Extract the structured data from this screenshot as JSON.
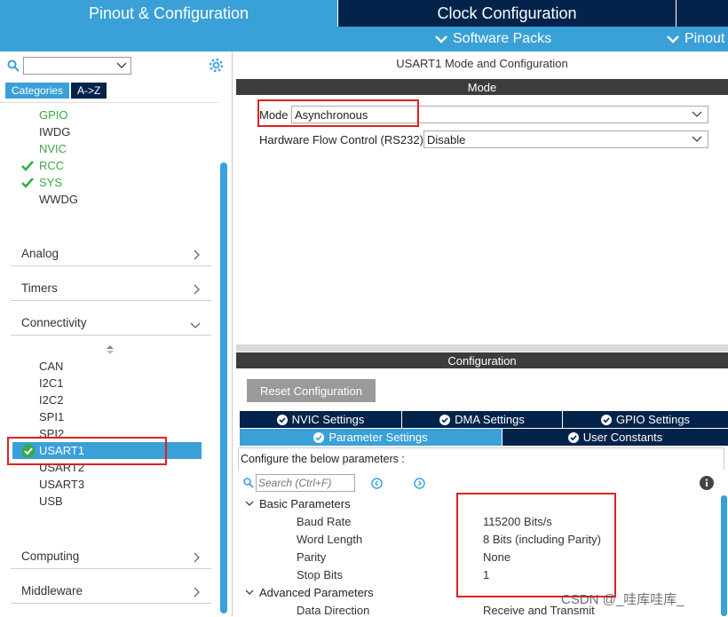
{
  "top_tabs": {
    "pinout": "Pinout & Configuration",
    "clock": "Clock Configuration"
  },
  "sub_menu": {
    "software_packs": "Software Packs",
    "pinout": "Pinout"
  },
  "left_panel": {
    "categories_tab": "Categories",
    "az_tab": "A->Z",
    "system_items": [
      {
        "label": "GPIO",
        "state": "green"
      },
      {
        "label": "IWDG",
        "state": "normal"
      },
      {
        "label": "NVIC",
        "state": "green"
      },
      {
        "label": "RCC",
        "state": "checked"
      },
      {
        "label": "SYS",
        "state": "checked"
      },
      {
        "label": "WWDG",
        "state": "normal"
      }
    ],
    "groups": {
      "analog": "Analog",
      "timers": "Timers",
      "connectivity": "Connectivity",
      "computing": "Computing",
      "middleware": "Middleware"
    },
    "connectivity_items": [
      "CAN",
      "I2C1",
      "I2C2",
      "SPI1",
      "SPI2",
      "USART1",
      "USART2",
      "USART3",
      "USB"
    ],
    "selected_item": "USART1"
  },
  "right_panel": {
    "title": "USART1 Mode and Configuration",
    "mode_header": "Mode",
    "mode_label": "Mode",
    "mode_value": "Asynchronous",
    "hw_flow_label": "Hardware Flow Control (RS232)",
    "hw_flow_value": "Disable",
    "config_header": "Configuration",
    "reset_button": "Reset Configuration",
    "tabs_row1": [
      "NVIC Settings",
      "DMA Settings",
      "GPIO Settings"
    ],
    "tabs_row2": [
      "Parameter Settings",
      "User Constants"
    ],
    "configure_text": "Configure the below parameters :",
    "search_placeholder": "Search (Ctrl+F)",
    "basic_params_label": "Basic Parameters",
    "params": [
      {
        "label": "Baud Rate",
        "value": "115200 Bits/s"
      },
      {
        "label": "Word Length",
        "value": "8 Bits (including Parity)"
      },
      {
        "label": "Parity",
        "value": "None"
      },
      {
        "label": "Stop Bits",
        "value": "1"
      }
    ],
    "advanced_params_label": "Advanced Parameters",
    "data_direction_label": "Data Direction",
    "data_direction_value": "Receive and Transmit"
  },
  "watermark": "CSDN @_哇库哇库_",
  "colors": {
    "accent": "#3aa0d8",
    "dark_navy": "#03234b",
    "green": "#3aa845",
    "highlight_red": "#e02020"
  }
}
